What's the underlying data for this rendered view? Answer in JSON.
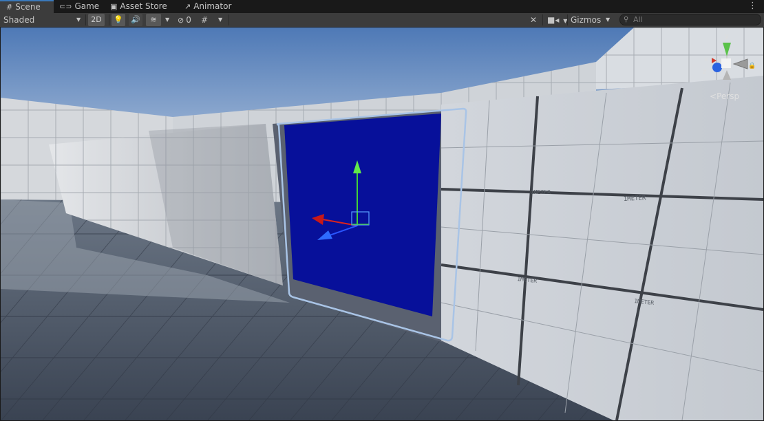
{
  "tabs": [
    {
      "label": "Scene",
      "icon": "hash-grid-icon",
      "active": true
    },
    {
      "label": "Game",
      "icon": "gamepad-icon",
      "active": false
    },
    {
      "label": "Asset Store",
      "icon": "store-bag-icon",
      "active": false
    },
    {
      "label": "Animator",
      "icon": "animator-icon",
      "active": false
    }
  ],
  "toolbar": {
    "shading_mode": "Shaded",
    "mode_2d": "2D",
    "hidden_count": "0",
    "gizmos_label": "Gizmos",
    "search_placeholder": "All"
  },
  "scene": {
    "projection_label": "Persp",
    "axes": {
      "x": "x",
      "y": "y",
      "z": "z"
    },
    "wall_text": "1METER",
    "sky_color": "#8aa6c8",
    "wall_color": "#dcdfe3",
    "floor_color": "#4c5766",
    "portal_color": "#07109a",
    "selection_outline_color": "#a9c4e6"
  }
}
